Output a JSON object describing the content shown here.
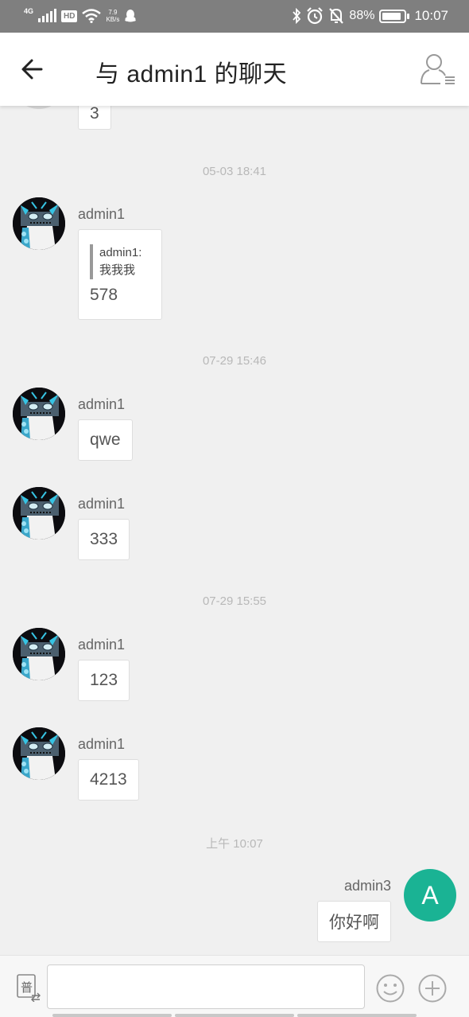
{
  "status_bar": {
    "network": "4G",
    "hd": "HD",
    "speed_value": "7.9",
    "speed_unit": "KB/s",
    "battery_pct": "88%",
    "battery_level": 0.88,
    "time": "10:07"
  },
  "header": {
    "title": "与 admin1 的聊天"
  },
  "colors": {
    "avatar_a_bg": "#1ab394",
    "background": "#f0f0f0"
  },
  "messages": {
    "partial_top_text": "3",
    "groups": [
      {
        "timestamp": "05-03 18:41",
        "items": [
          {
            "sender": "admin1",
            "quote_author": "admin1:",
            "quote_text": "我我我",
            "text": "578"
          }
        ]
      },
      {
        "timestamp": "07-29 15:46",
        "items": [
          {
            "sender": "admin1",
            "text": "qwe"
          },
          {
            "sender": "admin1",
            "text": "333"
          }
        ]
      },
      {
        "timestamp": "07-29 15:55",
        "items": [
          {
            "sender": "admin1",
            "text": "123"
          },
          {
            "sender": "admin1",
            "text": "4213"
          }
        ]
      },
      {
        "timestamp": "上午 10:07",
        "items": [
          {
            "sender": "admin3",
            "avatar_letter": "A",
            "text": "你好啊"
          }
        ]
      }
    ]
  },
  "input_bar": {
    "mode_label": "普",
    "value": "",
    "placeholder": ""
  }
}
